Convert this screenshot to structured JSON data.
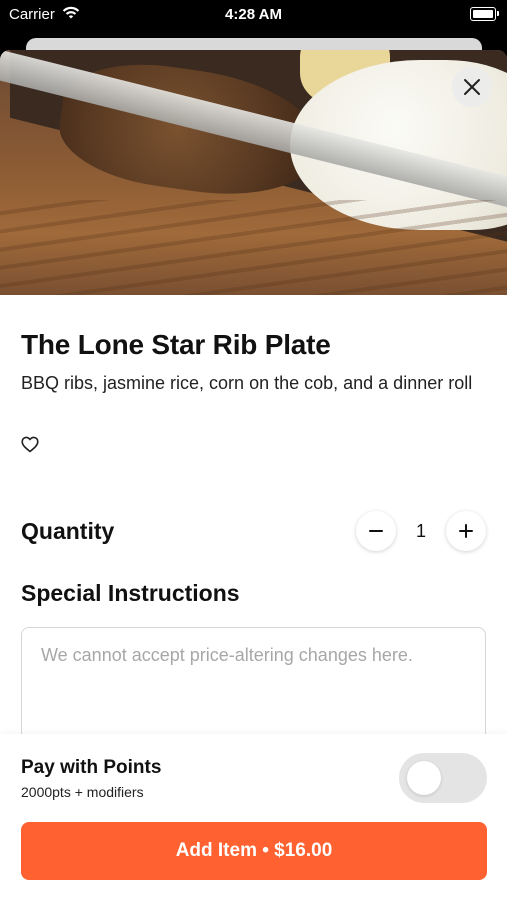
{
  "status_bar": {
    "carrier": "Carrier",
    "time": "4:28 AM"
  },
  "item": {
    "title": "The Lone Star Rib Plate",
    "description": "BBQ ribs, jasmine rice, corn on the cob, and a dinner roll"
  },
  "quantity": {
    "label": "Quantity",
    "value": "1",
    "minus": "−",
    "plus": "+"
  },
  "special_instructions": {
    "label": "Special Instructions",
    "placeholder": "We cannot accept price-altering changes here."
  },
  "pay_with_points": {
    "title": "Pay with Points",
    "subtitle": "2000pts + modifiers",
    "enabled": false
  },
  "add_button": {
    "label": "Add Item • $16.00"
  },
  "colors": {
    "accent": "#FF6130",
    "toggle_off": "#E4E4E4"
  }
}
